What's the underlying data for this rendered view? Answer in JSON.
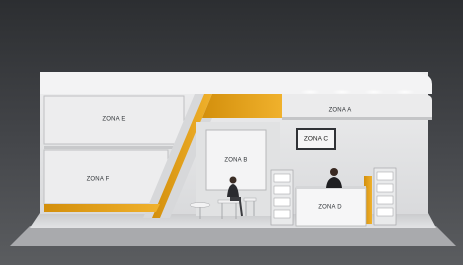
{
  "scene": {
    "zones": {
      "a": "ZONA A",
      "b": "ZONA B",
      "c": "ZONA C",
      "d": "ZONA D",
      "e": "ZONA E",
      "f": "ZONA F"
    },
    "colors": {
      "background": "#3d3f42",
      "wall": "#e7e8e9",
      "accent": "#e8a214",
      "floor": "#d7d8da"
    }
  }
}
